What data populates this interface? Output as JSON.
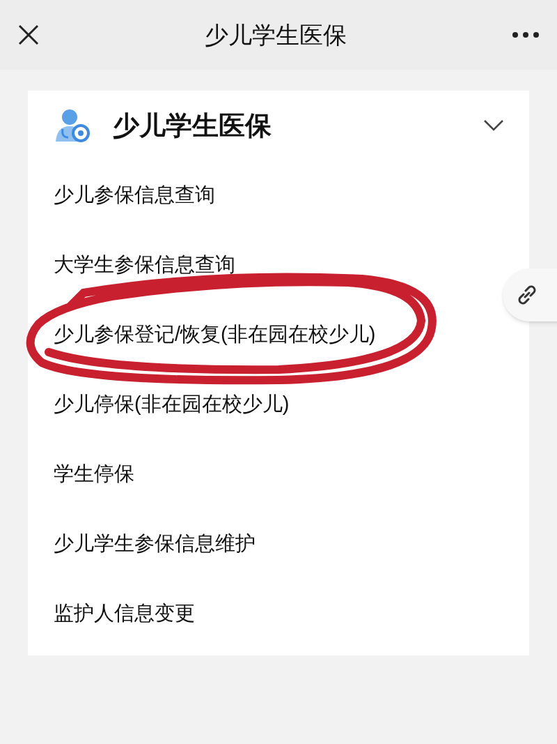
{
  "nav_bar": {
    "title": "少儿学生医保"
  },
  "card": {
    "title": "少儿学生医保",
    "expanded": true,
    "items": [
      {
        "label": "少儿参保信息查询"
      },
      {
        "label": "大学生参保信息查询"
      },
      {
        "label": "少儿参保登记/恢复(非在园在校少儿)"
      },
      {
        "label": "少儿停保(非在园在校少儿)"
      },
      {
        "label": "学生停保"
      },
      {
        "label": "少儿学生参保信息维护"
      },
      {
        "label": "监护人信息变更"
      }
    ]
  }
}
